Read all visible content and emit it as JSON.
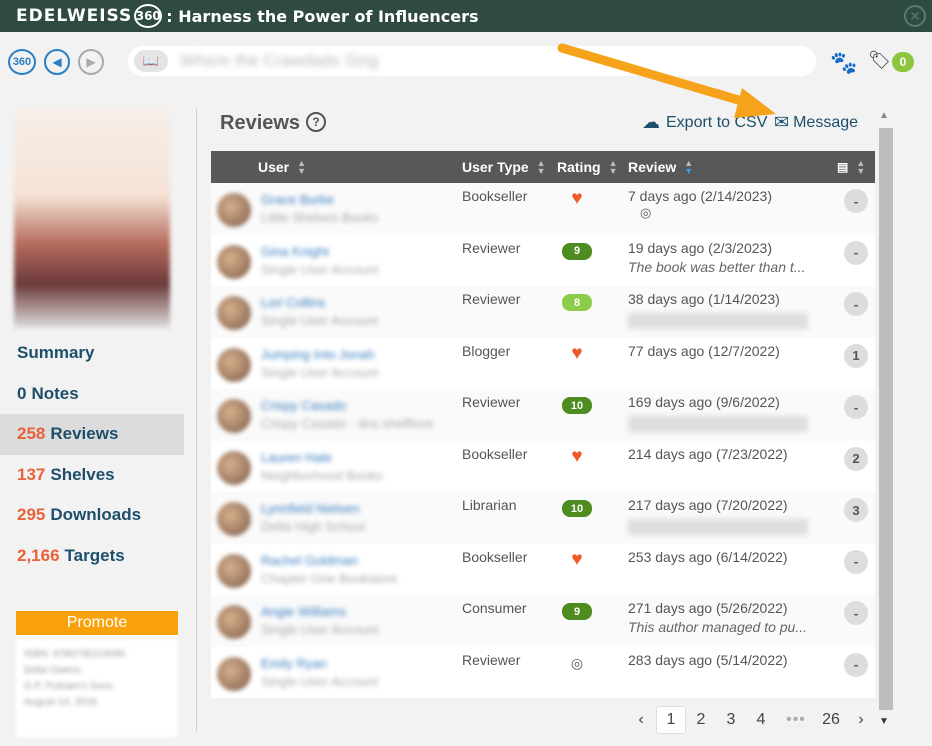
{
  "app": {
    "brand": "EDELWEISS",
    "brand_badge": "360",
    "tagline": ": Harness the Power of Influencers"
  },
  "toolbar": {
    "nav_360": "360",
    "book_title": "Where the Crawdads Sing",
    "tag_count": "0"
  },
  "sidebar": {
    "items": [
      {
        "num": "",
        "label": "Summary"
      },
      {
        "num": "0",
        "label": "Notes"
      },
      {
        "num": "258",
        "label": "Reviews"
      },
      {
        "num": "137",
        "label": "Shelves"
      },
      {
        "num": "295",
        "label": "Downloads"
      },
      {
        "num": "2,166",
        "label": "Targets"
      }
    ],
    "promote_label": "Promote",
    "promote_info": [
      "ISBN: 9780735219090",
      "Delia Owens",
      "G.P. Putnam's Sons",
      "August 14, 2018"
    ]
  },
  "main": {
    "title": "Reviews",
    "export_label": "Export to CSV",
    "message_label": "Message"
  },
  "table": {
    "headers": {
      "user": "User",
      "user_type": "User Type",
      "rating": "Rating",
      "review": "Review"
    },
    "rows": [
      {
        "name": "Grace Burke",
        "sub": "Little Shelves Books",
        "type": "Bookseller",
        "rating": "heart",
        "date": "7 days ago (2/14/2023)",
        "snippet": "",
        "count": "-"
      },
      {
        "name": "Gina Knight",
        "sub": "Single User Account",
        "type": "Reviewer",
        "rating": "9",
        "date": "19 days ago (2/3/2023)",
        "snippet": "The book was better than t...",
        "count": "-"
      },
      {
        "name": "Lori Collins",
        "sub": "Single User Account",
        "type": "Reviewer",
        "rating": "8",
        "date": "38 days ago (1/14/2023)",
        "snippet": "",
        "count": "-"
      },
      {
        "name": "Jumping Into Jonah",
        "sub": "Single User Account",
        "type": "Blogger",
        "rating": "heart",
        "date": "77 days ago (12/7/2022)",
        "snippet": "",
        "count": "1"
      },
      {
        "name": "Crispy Casado",
        "sub": "Crispy Casado - dns.shelflove",
        "type": "Reviewer",
        "rating": "10",
        "date": "169 days ago (9/6/2022)",
        "snippet": "",
        "count": "-"
      },
      {
        "name": "Lauren Hale",
        "sub": "Neighborhood Books",
        "type": "Bookseller",
        "rating": "heart",
        "date": "214 days ago (7/23/2022)",
        "snippet": "",
        "count": "2"
      },
      {
        "name": "Lynnfield Nielsen",
        "sub": "Delta High School",
        "type": "Librarian",
        "rating": "10",
        "date": "217 days ago (7/20/2022)",
        "snippet": "",
        "count": "3"
      },
      {
        "name": "Rachel Goldman",
        "sub": "Chapter One Bookstore",
        "type": "Bookseller",
        "rating": "heart",
        "date": "253 days ago (6/14/2022)",
        "snippet": "",
        "count": "-"
      },
      {
        "name": "Angie Williams",
        "sub": "Single User Account",
        "type": "Consumer",
        "rating": "9",
        "date": "271 days ago (5/26/2022)",
        "snippet": "This author managed to pu...",
        "count": "-"
      },
      {
        "name": "Emily Ryan",
        "sub": "Single User Account",
        "type": "Reviewer",
        "rating": "hidden",
        "date": "283 days ago (5/14/2022)",
        "snippet": "",
        "count": "-"
      }
    ]
  },
  "pager": {
    "pages": [
      "1",
      "2",
      "3",
      "4"
    ],
    "last": "26",
    "current": "1"
  },
  "colors": {
    "titlebar": "#2e4a41",
    "link": "#1d4f6b",
    "accent_orange": "#e8623a",
    "promote": "#f9a10b",
    "rating_green": "#4f8c1f",
    "rating_light": "#8dcc4a",
    "heart": "#f05a28"
  }
}
